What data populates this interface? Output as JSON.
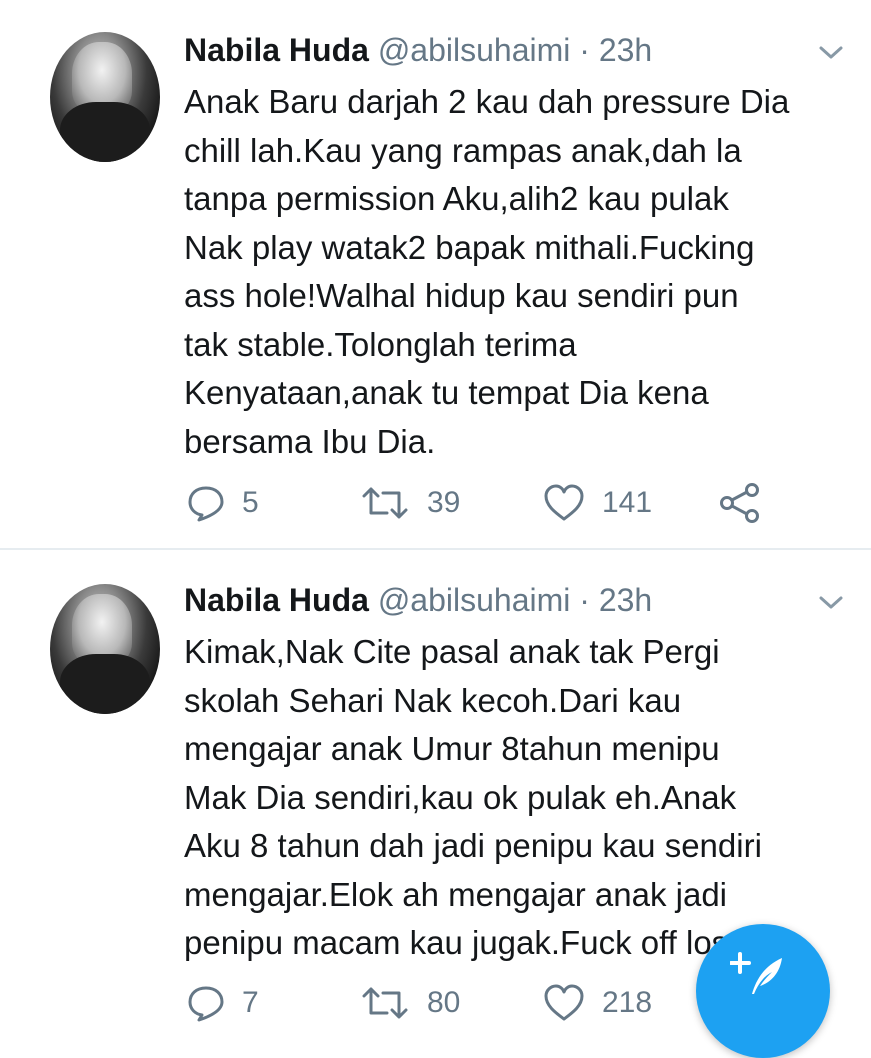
{
  "tweets": [
    {
      "name": "Nabila Huda",
      "handle": "@abilsuhaimi",
      "separator": " · ",
      "time": "23h",
      "lines": [
        "Anak Baru darjah 2 kau dah pressure Dia",
        "chill lah.Kau yang rampas anak,dah la",
        "tanpa permission Aku,alih2 kau pulak",
        "Nak play watak2 bapak mithali.Fucking",
        "ass hole!Walhal hidup kau sendiri pun",
        "tak stable.Tolonglah terima",
        "Kenyataan,anak tu tempat Dia kena",
        "bersama Ibu Dia."
      ],
      "replies": "5",
      "retweets": "39",
      "likes": "141"
    },
    {
      "name": "Nabila Huda",
      "handle": "@abilsuhaimi",
      "separator": " · ",
      "time": "23h",
      "lines": [
        "Kimak,Nak Cite pasal anak tak Pergi",
        "skolah Sehari Nak kecoh.Dari kau",
        "mengajar anak Umur 8tahun menipu",
        "Mak Dia sendiri,kau ok pulak eh.Anak",
        "Aku 8 tahun dah jadi penipu kau sendiri",
        "mengajar.Elok ah mengajar anak jadi",
        "penipu macam kau jugak.Fuck off loser!"
      ],
      "replies": "7",
      "retweets": "80",
      "likes": "218"
    }
  ],
  "icons": {
    "reply": "reply-icon",
    "retweet": "retweet-icon",
    "like": "heart-icon",
    "share": "share-icon",
    "more": "chevron-down-icon",
    "compose": "compose-tweet-icon"
  },
  "colors": {
    "text": "#14171a",
    "secondary": "#657786",
    "accent": "#1da1f2",
    "divider": "#e6ecf0"
  }
}
